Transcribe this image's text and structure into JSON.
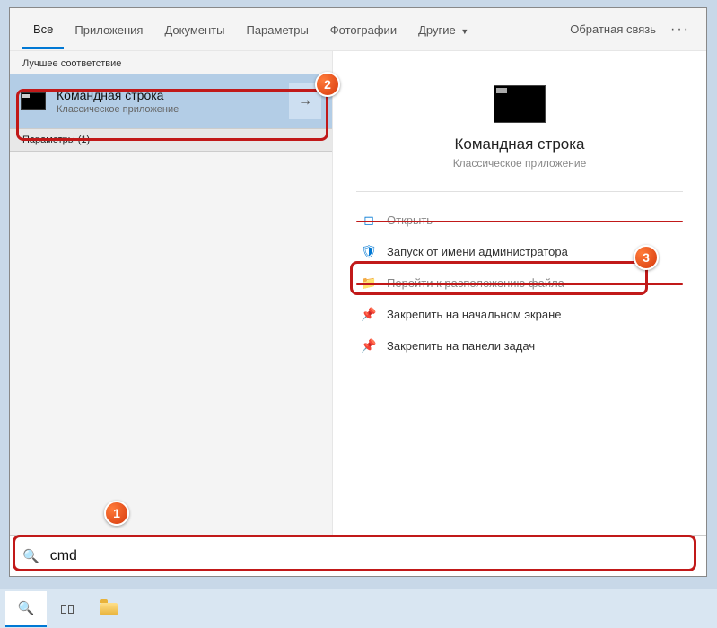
{
  "tabs": {
    "all": "Все",
    "apps": "Приложения",
    "docs": "Документы",
    "settings": "Параметры",
    "photos": "Фотографии",
    "other": "Другие",
    "feedback": "Обратная связь"
  },
  "section_best_match": "Лучшее соответствие",
  "result": {
    "title": "Командная строка",
    "subtitle": "Классическое приложение"
  },
  "left_footer": "Параметры (1)",
  "details": {
    "title": "Командная строка",
    "subtitle": "Классическое приложение"
  },
  "actions": {
    "open": "Открыть",
    "run_admin": "Запуск от имени администратора",
    "open_location": "Перейти к расположению файла",
    "pin_start": "Закрепить на начальном экране",
    "pin_taskbar": "Закрепить на панели задач"
  },
  "search": {
    "value": "cmd"
  },
  "badges": {
    "one": "1",
    "two": "2",
    "three": "3"
  }
}
